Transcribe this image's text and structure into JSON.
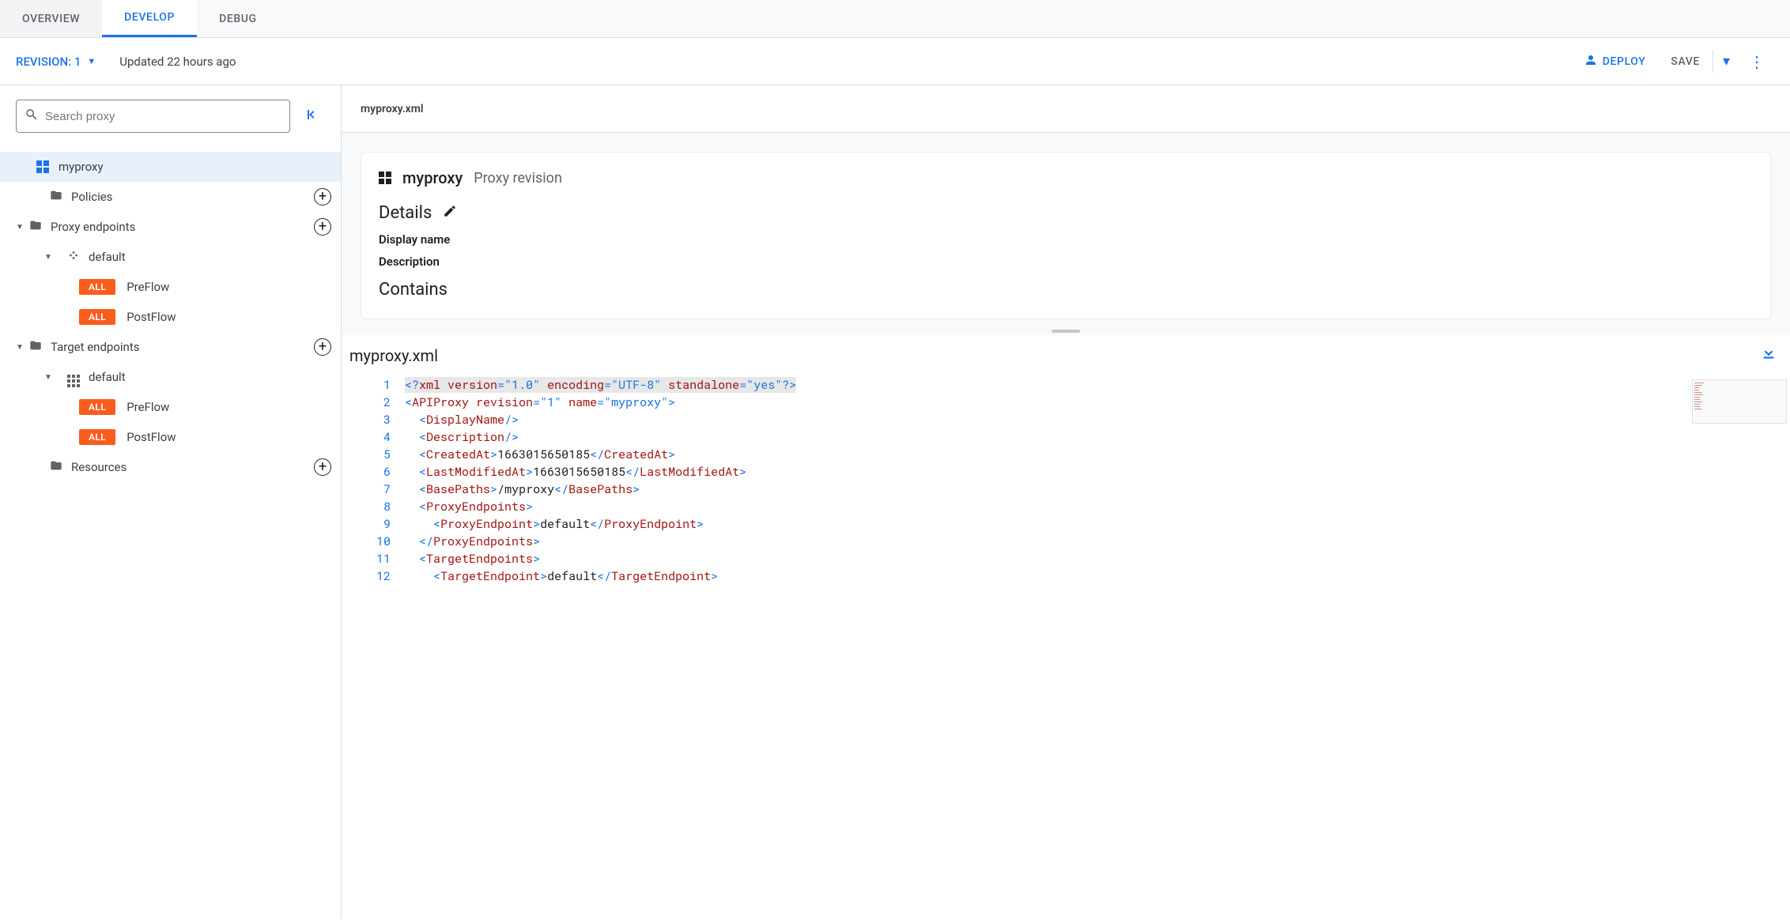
{
  "tabs": {
    "overview": "OVERVIEW",
    "develop": "DEVELOP",
    "debug": "DEBUG"
  },
  "toolbar": {
    "revision_label": "REVISION: 1",
    "updated_text": "Updated 22 hours ago",
    "deploy_label": "DEPLOY",
    "save_label": "SAVE"
  },
  "sidebar": {
    "search_placeholder": "Search proxy",
    "nodes": {
      "root": "myproxy",
      "policies": "Policies",
      "proxy_endpoints": "Proxy endpoints",
      "proxy_default": "default",
      "preflow": "PreFlow",
      "postflow": "PostFlow",
      "target_endpoints": "Target endpoints",
      "target_default": "default",
      "resources": "Resources",
      "badge_all": "ALL"
    }
  },
  "main": {
    "file_name_top": "myproxy.xml",
    "card": {
      "title": "myproxy",
      "subtitle": "Proxy revision",
      "details_header": "Details",
      "display_name_label": "Display name",
      "description_label": "Description",
      "contains_header": "Contains"
    },
    "editor_file_name": "myproxy.xml"
  },
  "code": {
    "filename": "myproxy.xml",
    "revision": "1",
    "name": "myproxy",
    "created_at": "1663015650185",
    "last_modified_at": "1663015650185",
    "base_path": "/myproxy",
    "proxy_endpoint": "default",
    "target_endpoint": "default",
    "lines": [
      "1",
      "2",
      "3",
      "4",
      "5",
      "6",
      "7",
      "8",
      "9",
      "10",
      "11",
      "12"
    ]
  }
}
